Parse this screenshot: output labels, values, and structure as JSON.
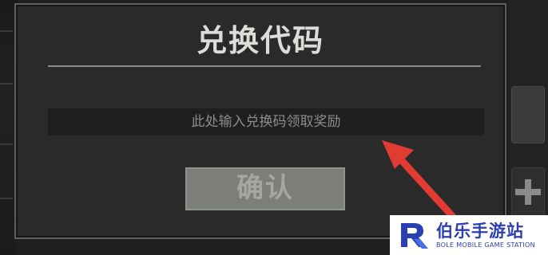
{
  "dialog": {
    "title": "兑换代码",
    "input": {
      "placeholder": "此处输入兑换码领取奖励",
      "value": ""
    },
    "confirm_label": "确认"
  },
  "annotation": {
    "arrow_color": "#e23b34"
  },
  "watermark": {
    "name_cn": "伯乐手游站",
    "name_en": "BOLE MOBILE GAME STATION",
    "brand_color": "#2c3fb0"
  }
}
